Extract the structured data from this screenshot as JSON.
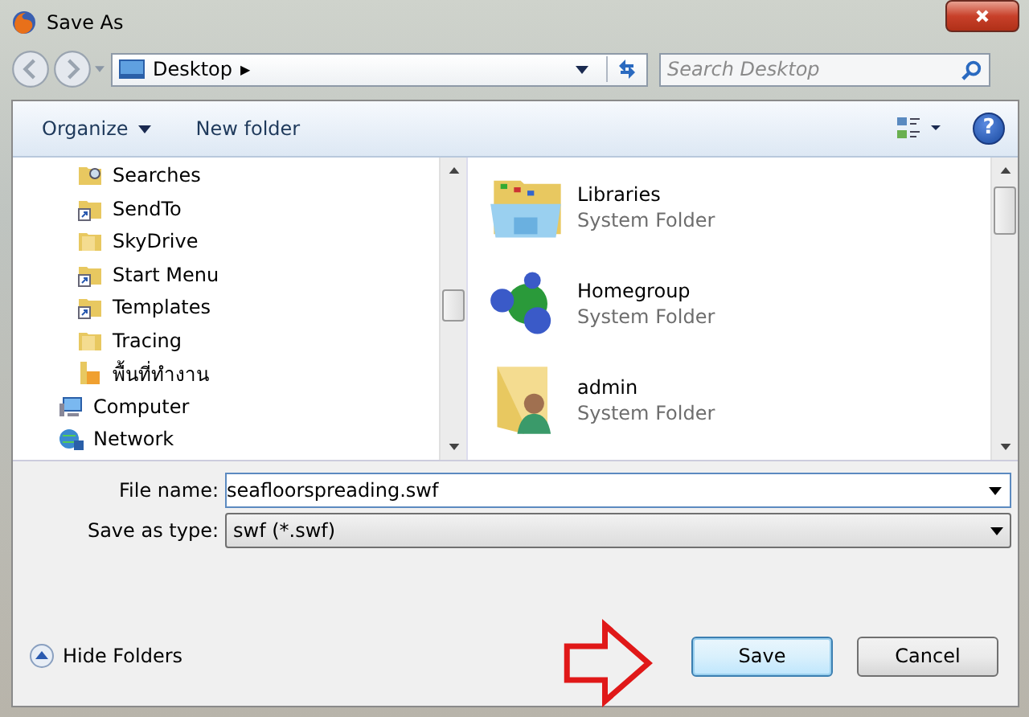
{
  "window": {
    "title": "Save As"
  },
  "address_bar": {
    "location": "Desktop",
    "separator": "▶"
  },
  "search": {
    "placeholder": "Search Desktop"
  },
  "toolbar": {
    "organize": "Organize",
    "new_folder": "New folder",
    "help": "?"
  },
  "sidebar": {
    "nested_items": [
      {
        "label": "Searches",
        "kind": "search"
      },
      {
        "label": "SendTo",
        "kind": "shortcut"
      },
      {
        "label": "SkyDrive",
        "kind": "folder"
      },
      {
        "label": "Start Menu",
        "kind": "shortcut"
      },
      {
        "label": "Templates",
        "kind": "shortcut"
      },
      {
        "label": "Tracing",
        "kind": "folder"
      },
      {
        "label": "พื้นที่ทำงาน",
        "kind": "desktop"
      }
    ],
    "items": [
      {
        "label": "Computer",
        "kind": "computer"
      },
      {
        "label": "Network",
        "kind": "network"
      }
    ]
  },
  "files": [
    {
      "name": "Libraries",
      "type": "System Folder",
      "kind": "libraries"
    },
    {
      "name": "Homegroup",
      "type": "System Folder",
      "kind": "homegroup"
    },
    {
      "name": "admin",
      "type": "System Folder",
      "kind": "user"
    }
  ],
  "form": {
    "file_name_label": "File name:",
    "file_name": "seafloorspreading.swf",
    "type_label": "Save as type:",
    "type_value": "swf (*.swf)"
  },
  "hide_folders": "Hide Folders",
  "buttons": [
    {
      "label": "Save",
      "kind": "default"
    },
    {
      "label": "Cancel",
      "kind": "normal"
    }
  ]
}
